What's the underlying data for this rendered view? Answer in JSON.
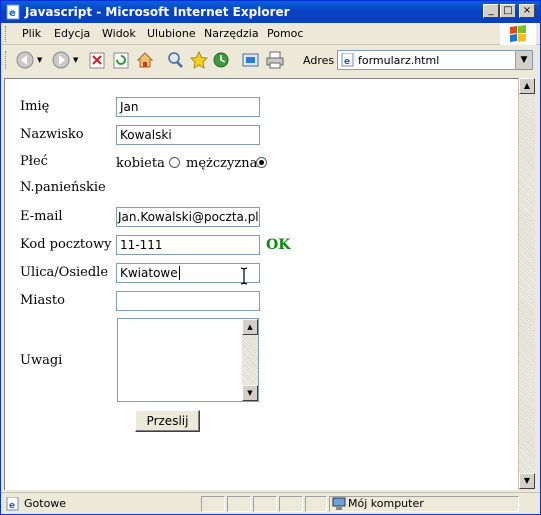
{
  "window": {
    "title": "Javascript - Microsoft Internet Explorer",
    "buttons": {
      "minimize": "_",
      "maximize": "□",
      "close": "×"
    }
  },
  "menu": {
    "items": [
      "Plik",
      "Edycja",
      "Widok",
      "Ulubione",
      "Narzędzia",
      "Pomoc"
    ]
  },
  "toolbar": {
    "address_label": "Adres",
    "address_value": "formularz.html",
    "icons": [
      "back-icon",
      "forward-icon",
      "stop-icon",
      "refresh-icon",
      "home-icon",
      "search-icon",
      "favorites-icon",
      "history-icon",
      "mail-icon",
      "print-icon"
    ]
  },
  "form": {
    "imie": {
      "label": "Imię",
      "value": "Jan"
    },
    "nazwisko": {
      "label": "Nazwisko",
      "value": "Kowalski"
    },
    "plec": {
      "label": "Płeć",
      "option_female": "kobieta",
      "option_male": "mężczyzna",
      "selected": "mężczyzna"
    },
    "panienskie": {
      "label": "N.panieńskie"
    },
    "email": {
      "label": "E-mail",
      "value": "Jan.Kowalski@poczta.pl"
    },
    "kod": {
      "label": "Kod pocztowy",
      "value": "11-111",
      "status": "OK"
    },
    "ulica": {
      "label": "Ulica/Osiedle",
      "value": "Kwiatowe"
    },
    "miasto": {
      "label": "Miasto",
      "value": ""
    },
    "uwagi": {
      "label": "Uwagi",
      "value": ""
    },
    "submit_label": "Przeslij"
  },
  "status": {
    "text": "Gotowe",
    "zone": "Mój komputer"
  }
}
